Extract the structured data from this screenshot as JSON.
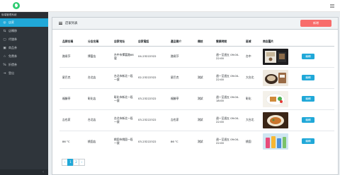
{
  "sidebar": {
    "header": "後端管理系統",
    "items": [
      {
        "label": "店家",
        "icon": "store-icon"
      },
      {
        "label": "店轉移",
        "icon": "transfer-icon"
      },
      {
        "label": "代儲券",
        "icon": "coupon-icon"
      },
      {
        "label": "商品券",
        "icon": "voucher-icon"
      },
      {
        "label": "免費券",
        "icon": "gift-icon"
      },
      {
        "label": "折價券",
        "icon": "discount-icon"
      },
      {
        "label": "登出",
        "icon": "logout-icon"
      }
    ],
    "collapse_glyph": "‹"
  },
  "card": {
    "title": "店家列表",
    "add_label": "新增"
  },
  "table": {
    "headers": [
      "品牌名稱",
      "分店名稱",
      "店家地址",
      "店家電話",
      "產品簡介",
      "備註",
      "營業時間",
      "區域",
      "商店圖片",
      ""
    ],
    "rows": [
      {
        "brand": "路易莎",
        "branch": "擇富店",
        "address": "台中市擇富路66號",
        "phone": "04-23222322",
        "intro": "路易莎",
        "note": "",
        "hours": "週一至週五 09:00-22:00",
        "area": "台中",
        "edit": "編輯"
      },
      {
        "brand": "星巴克",
        "branch": "台北店",
        "address": "台北市新北一段一號",
        "phone": "02-23222322",
        "intro": "星巴克",
        "note": "測試",
        "hours": "週一至週五 09:00-22:00",
        "area": "大台北",
        "edit": "編輯"
      },
      {
        "brand": "福勝亭",
        "branch": "彰化店",
        "address": "彰化市新北一段一號",
        "phone": "03-23222322",
        "intro": "福勝亭",
        "note": "測試",
        "hours": "週一至週五 09:00-18:00",
        "area": "彰化",
        "edit": "編輯"
      },
      {
        "brand": "吉也家",
        "branch": "台北店",
        "address": "台北市新北一段一號",
        "phone": "03-23222322",
        "intro": "吉也家",
        "note": "測試",
        "hours": "週一至週五 09:00-22:00",
        "area": "大台北",
        "edit": "編輯"
      },
      {
        "brand": "86 °C",
        "branch": "桃園店",
        "address": "桃園市桃園一段一號",
        "phone": "03-23222322",
        "intro": "86 °C",
        "note": "測試",
        "hours": "週一至週五 09:00-22:00",
        "area": "桃園",
        "edit": "編輯"
      }
    ]
  },
  "pagination": {
    "prev": "‹",
    "pages": [
      "1",
      "2"
    ],
    "next": "›",
    "current": "1"
  },
  "colors": {
    "accent": "#20a8d8",
    "danger": "#f86c6b",
    "sidebar": "#2f353b",
    "logo": "#2ecc71"
  }
}
